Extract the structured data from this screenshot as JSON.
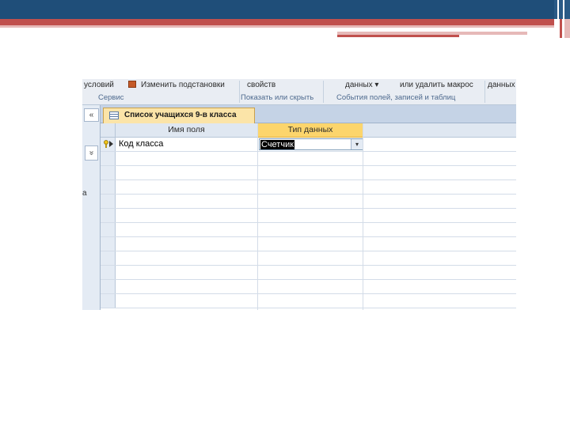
{
  "ribbon": {
    "top_items": [
      "условий",
      "Изменить подстановки",
      "свойств",
      "данных ▾",
      "или удалить макрос",
      "данных"
    ],
    "groups": [
      "Сервис",
      "Показать или скрыть",
      "События полей, записей и таблиц"
    ]
  },
  "nav": {
    "collapse_glyph": "«",
    "expand_glyph": "»",
    "partial_text": "а"
  },
  "tab": {
    "label": "Список учащихся 9-в класса"
  },
  "grid": {
    "columns": [
      "Имя поля",
      "Тип данных"
    ],
    "rows": [
      {
        "field_name": "Код класса",
        "data_type": "Счетчик",
        "primary_key": true
      }
    ],
    "dropdown_glyph": "▾"
  },
  "colors": {
    "slide_band": "#1f4e79",
    "slide_accent": "#c0504d",
    "tab_active": "#fbe4a8",
    "header_active": "#fcd56c"
  }
}
